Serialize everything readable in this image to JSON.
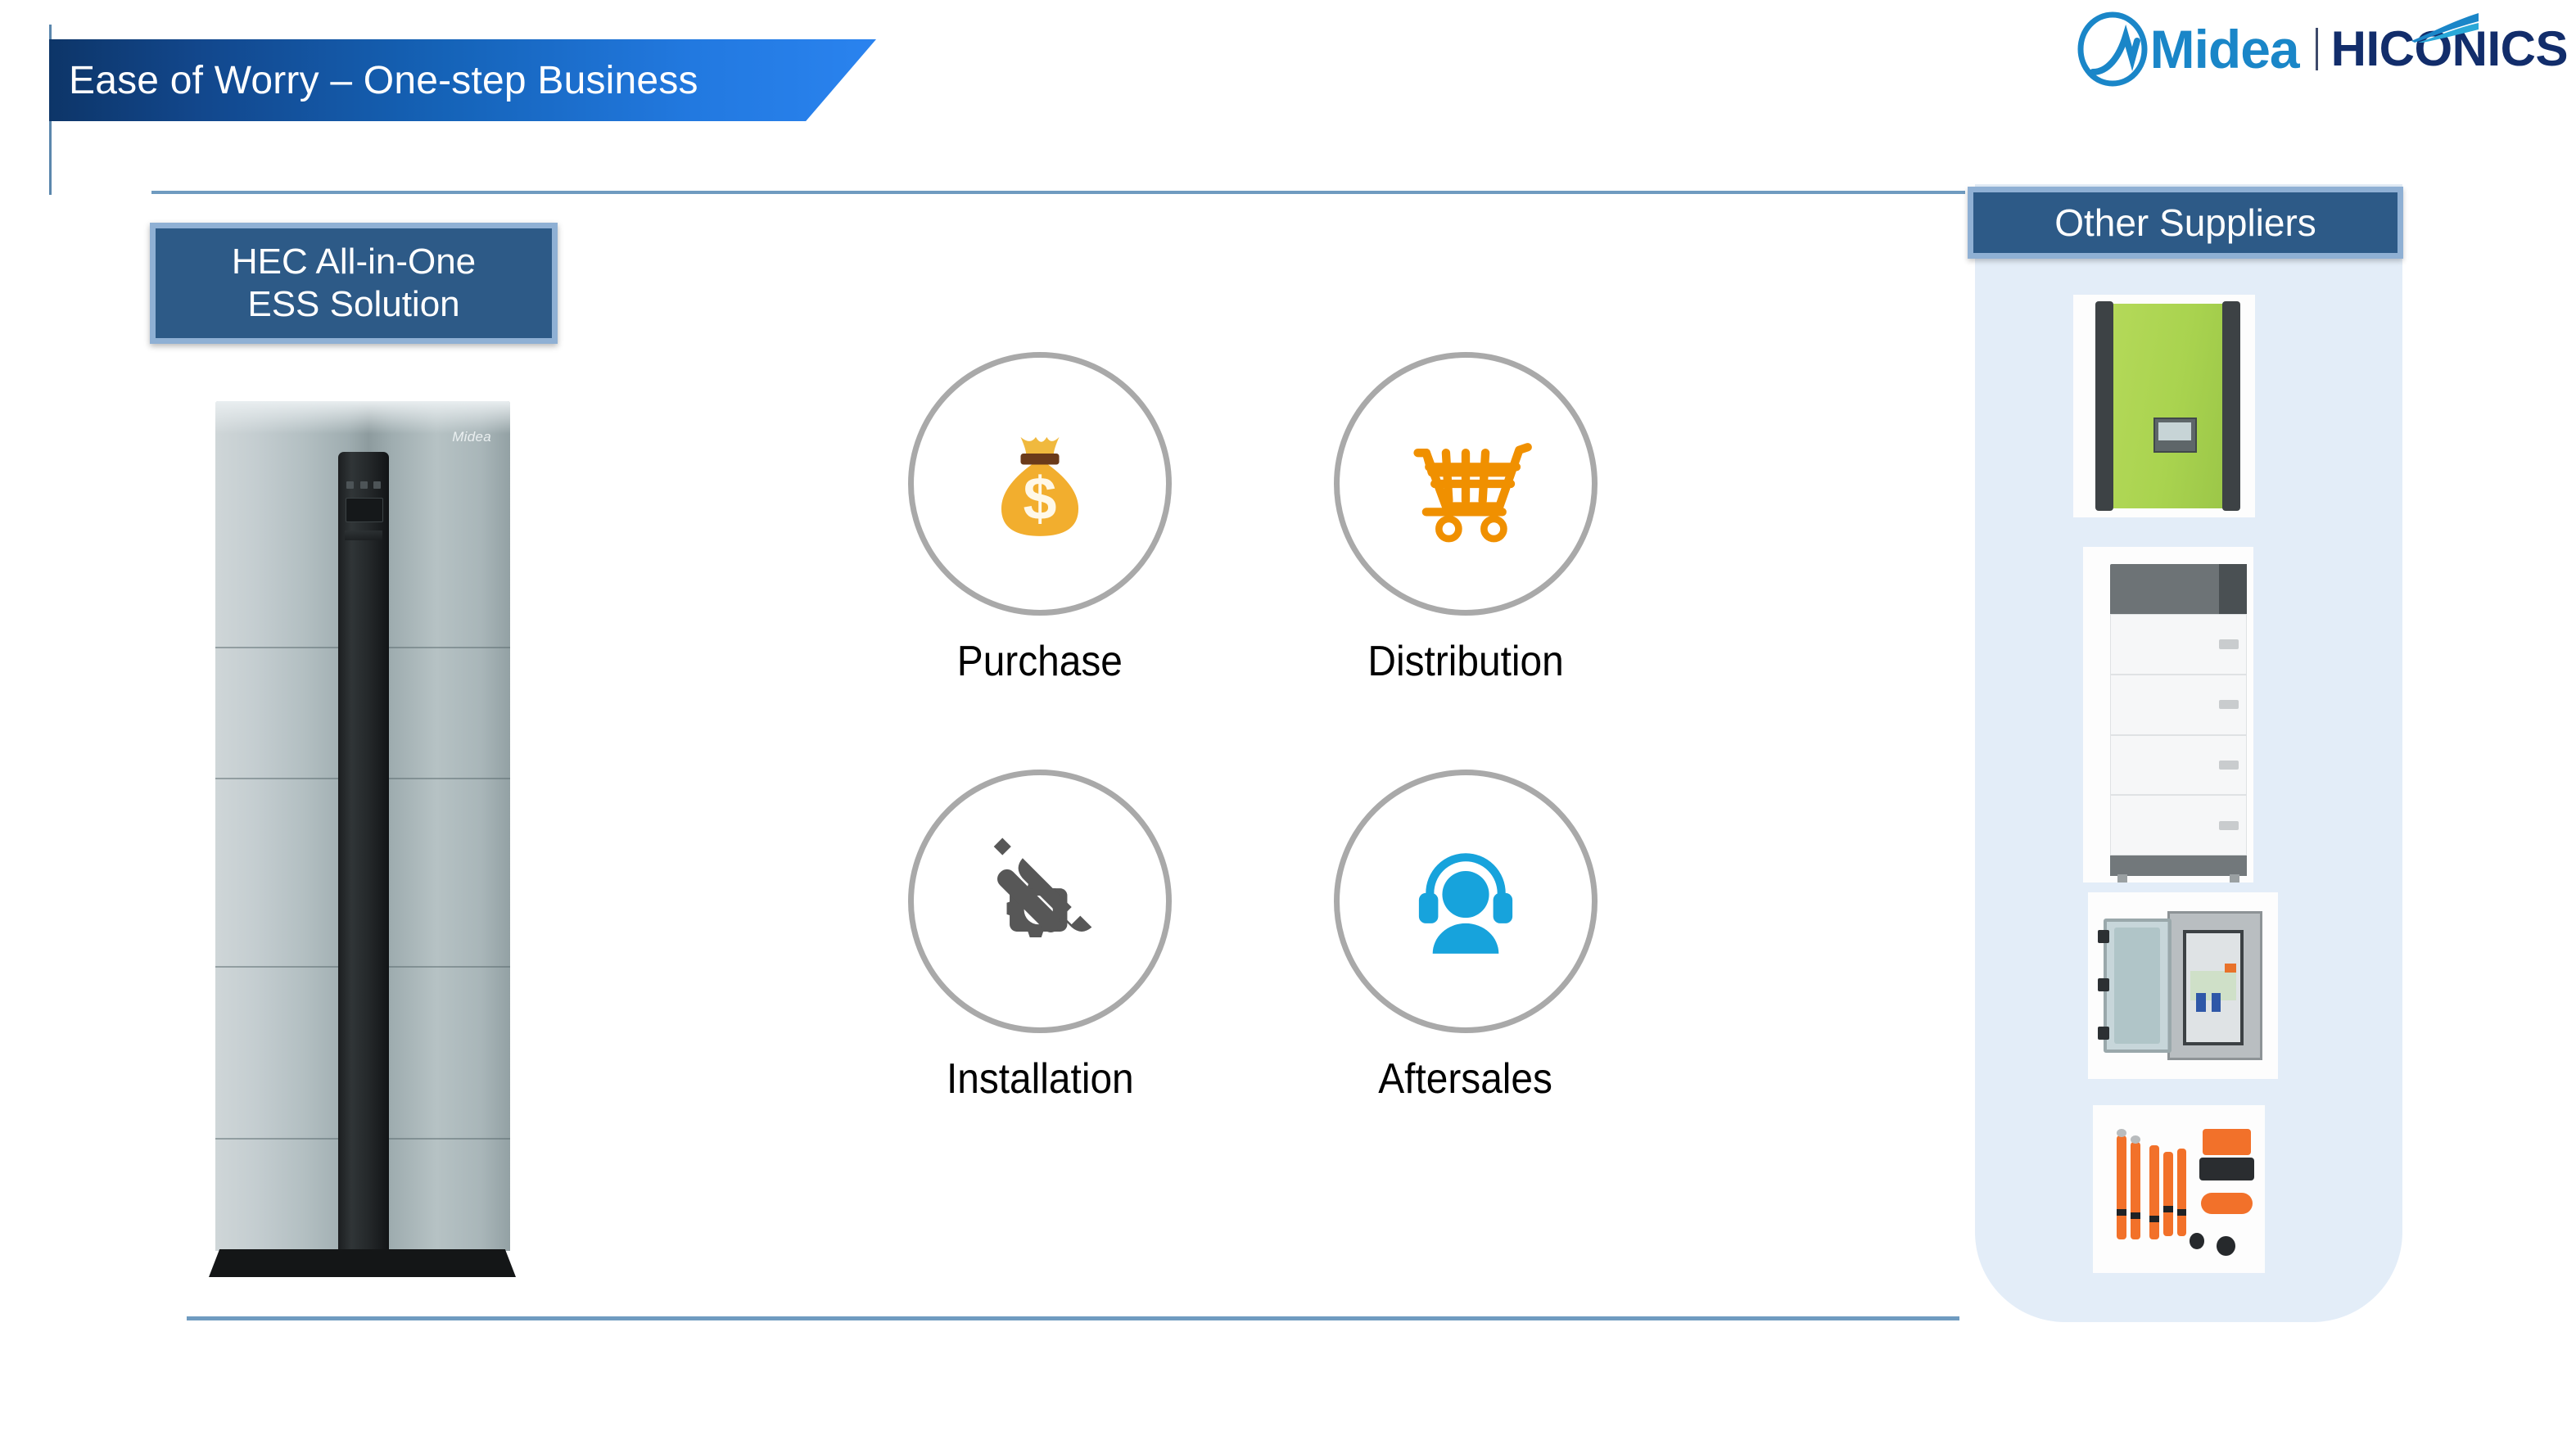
{
  "slide": {
    "title": "Ease of Worry – One-step Business"
  },
  "brand": {
    "primary": "Midea",
    "secondary": "HICONICS",
    "primary_color": "#1a86c8",
    "secondary_color": "#122d6b"
  },
  "product": {
    "label_line1": "HEC All-in-One",
    "label_line2": "ESS Solution",
    "unit_brand": "Midea"
  },
  "steps": [
    {
      "label": "Purchase",
      "icon": "money-bag-icon",
      "icon_color": "#F0A82E"
    },
    {
      "label": "Distribution",
      "icon": "shopping-cart-icon",
      "icon_color": "#F09000"
    },
    {
      "label": "Installation",
      "icon": "gear-wrench-icon",
      "icon_color": "#575757"
    },
    {
      "label": "Aftersales",
      "icon": "support-headset-icon",
      "icon_color": "#17A3DC"
    }
  ],
  "suppliers": {
    "header": "Other Suppliers",
    "items": [
      {
        "name": "green-inverter"
      },
      {
        "name": "stacked-battery-tower"
      },
      {
        "name": "combiner-box"
      },
      {
        "name": "hv-cable-set"
      }
    ]
  },
  "theme": {
    "banner_start": "#0d3568",
    "banner_end": "#2a83ef",
    "box_fill": "#2d5a87",
    "box_border": "#8fb0d4",
    "panel_bg": "#e3edf8",
    "rule_color": "#6f9bc0",
    "ring_color": "#a9a9a9"
  }
}
